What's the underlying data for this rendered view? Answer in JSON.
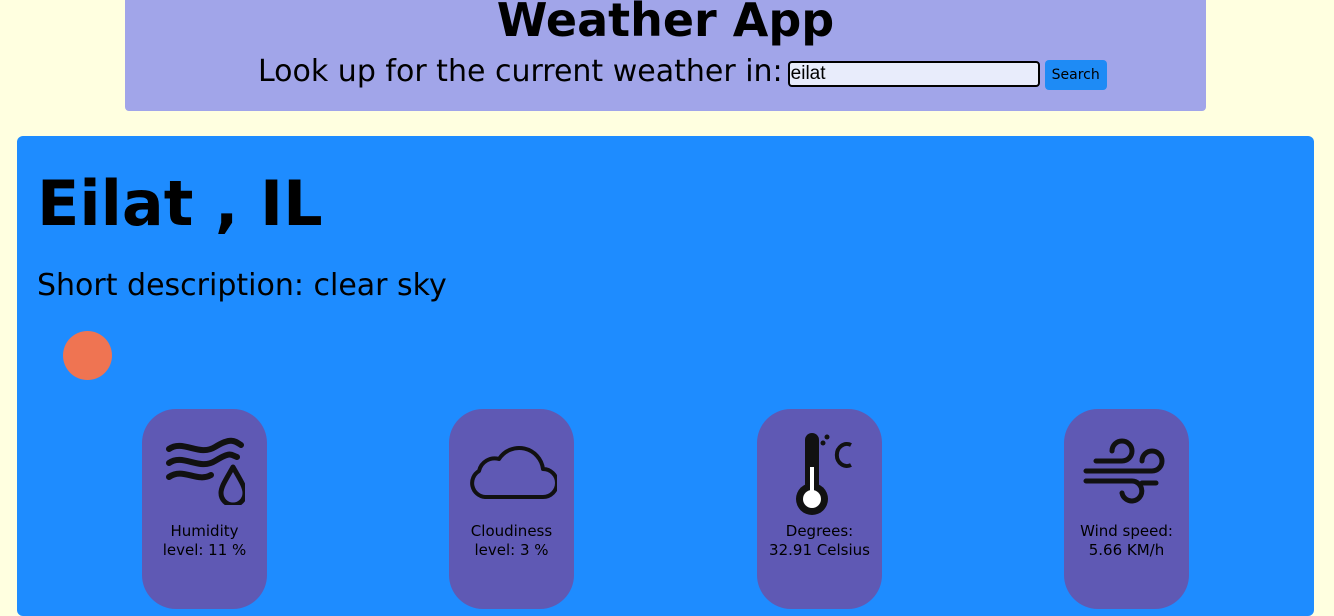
{
  "header": {
    "title": "Weather App",
    "lookup_label": "Look up for the current weather in:",
    "search_value": "eilat",
    "search_button": "Search"
  },
  "weather": {
    "city": "Eilat , IL",
    "description": "Short description: clear sky",
    "sun_color": "#ef7452",
    "stats": {
      "humidity": "Humidity level: 11 %",
      "cloudiness": "Cloudiness level: 3 %",
      "degrees": "Degrees: 32.91 Celsius",
      "wind": "Wind speed: 5.66 KM/h"
    },
    "stat_icons": [
      "humidity-icon",
      "cloud-icon",
      "thermometer-celsius-icon",
      "wind-icon"
    ]
  },
  "colors": {
    "page_background": "#ffffe0",
    "header_background": "#a1a5e9",
    "card_background": "#1e8cff",
    "stat_background": "#5f59b4",
    "button_background": "#1e8bf5"
  }
}
